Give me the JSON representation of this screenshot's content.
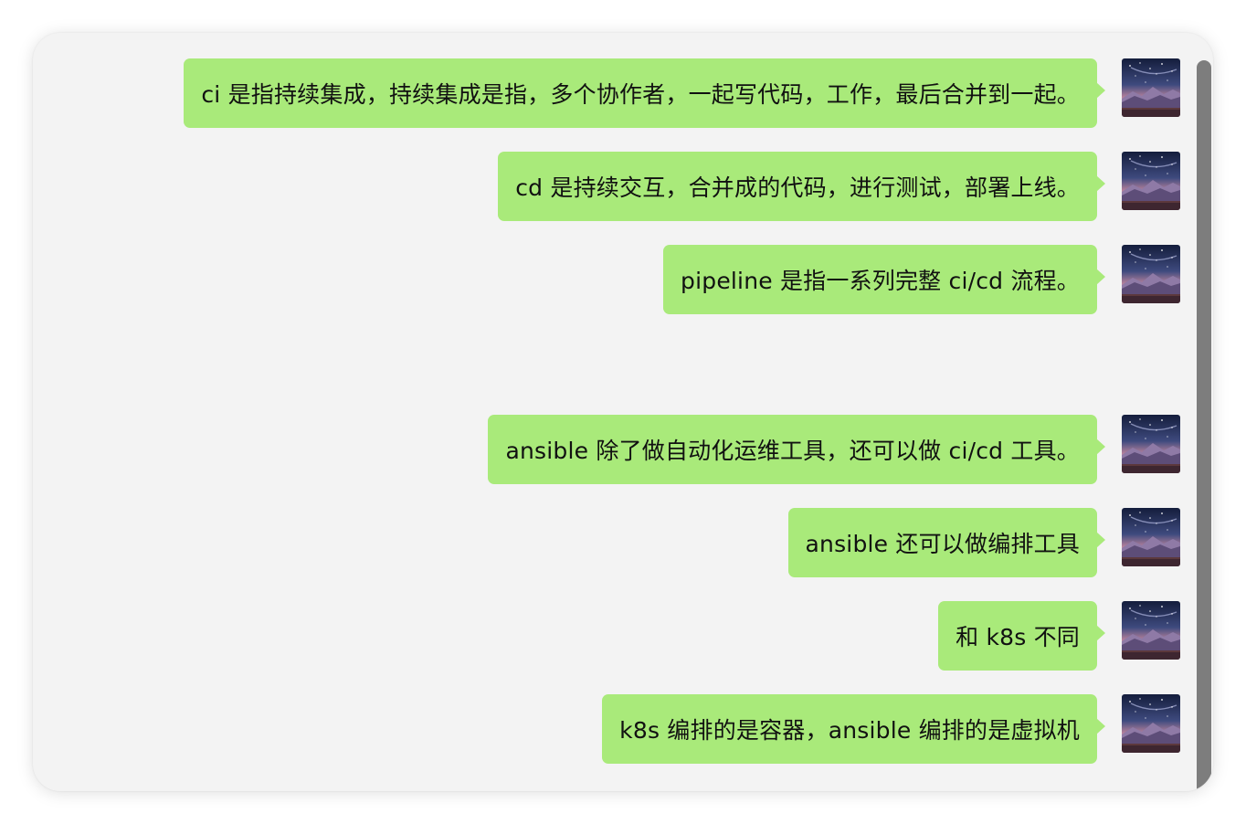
{
  "messages": [
    {
      "text": "ci 是指持续集成，持续集成是指，多个协作者，一起写代码，工作，最后合并到一起。"
    },
    {
      "text": "cd 是持续交互，合并成的代码，进行测试，部署上线。"
    },
    {
      "text": "pipeline 是指一系列完整 ci/cd 流程。"
    },
    {
      "text": "ansible 除了做自动化运维工具，还可以做 ci/cd 工具。"
    },
    {
      "text": "ansible 还可以做编排工具"
    },
    {
      "text": "和 k8s 不同"
    },
    {
      "text": "k8s 编排的是容器，ansible 编排的是虚拟机"
    }
  ],
  "avatar": {
    "icon": "starry-night-mountain-avatar-icon"
  },
  "colors": {
    "bubble": "#a9ea7a",
    "background": "#f3f3f3",
    "scrollbar": "#7d7d7d"
  }
}
